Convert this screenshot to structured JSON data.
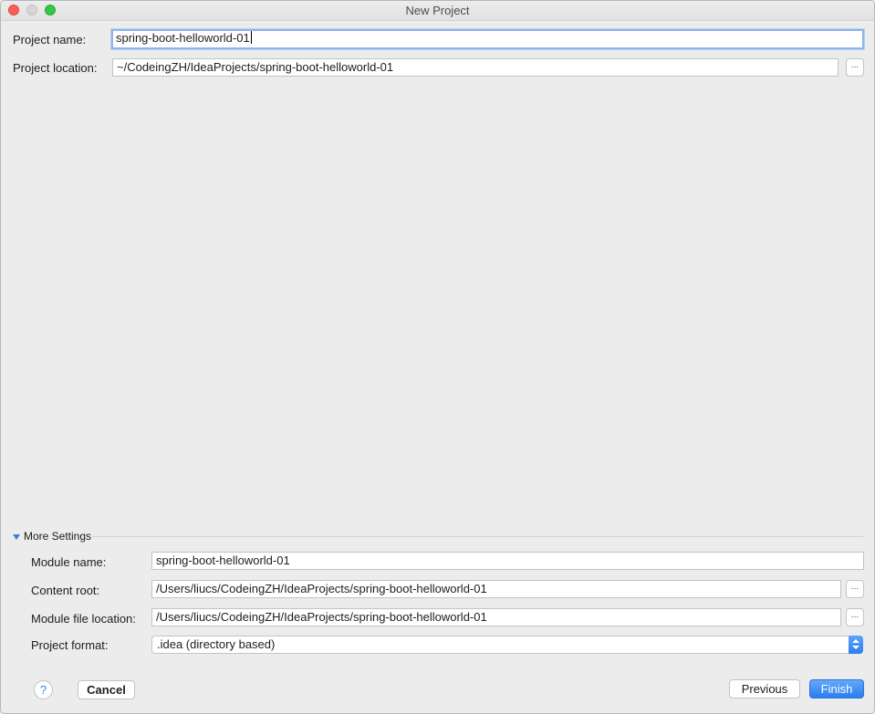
{
  "window": {
    "title": "New Project"
  },
  "project": {
    "name_label": "Project name:",
    "name_value": "spring-boot-helloworld-01",
    "location_label": "Project location:",
    "location_value": "~/CodeingZH/IdeaProjects/spring-boot-helloworld-01",
    "browse_label": "..."
  },
  "more_settings": {
    "header": "More Settings",
    "module_name_label": "Module name:",
    "module_name_value": "spring-boot-helloworld-01",
    "content_root_label": "Content root:",
    "content_root_value": "/Users/liucs/CodeingZH/IdeaProjects/spring-boot-helloworld-01",
    "module_file_label": "Module file location:",
    "module_file_value": "/Users/liucs/CodeingZH/IdeaProjects/spring-boot-helloworld-01",
    "format_label": "Project format:",
    "format_value": ".idea (directory based)"
  },
  "buttons": {
    "help": "?",
    "cancel": "Cancel",
    "previous": "Previous",
    "finish": "Finish"
  },
  "colors": {
    "accent": "#2a7df0",
    "background": "#ececec"
  }
}
